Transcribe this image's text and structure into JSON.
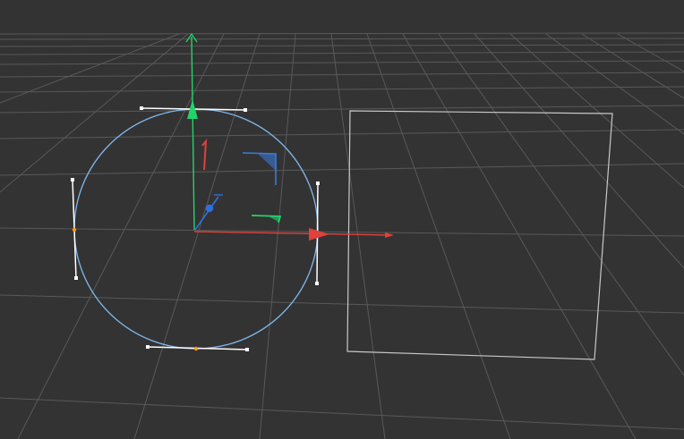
{
  "viewport": {
    "background": "#333333",
    "grid_color": "#595959",
    "horizon_color": "#4a4a4a"
  },
  "gizmo": {
    "x_axis_color": "#e0413c",
    "y_axis_color": "#22d36a",
    "z_axis_color": "#2f6fe0",
    "xy_plane_color": "#3a7be0",
    "xz_plane_color": "#22d36a",
    "yz_plane_color": "#e0413c"
  },
  "objects": [
    {
      "name": "circle",
      "type": "spline-circle",
      "color": "#7fb8ee"
    },
    {
      "name": "rectangle",
      "type": "spline-rectangle",
      "color": "#c8c8c8"
    }
  ],
  "handles": {
    "tangent_color": "#ffffff",
    "point_color": "#ff9a1f"
  }
}
